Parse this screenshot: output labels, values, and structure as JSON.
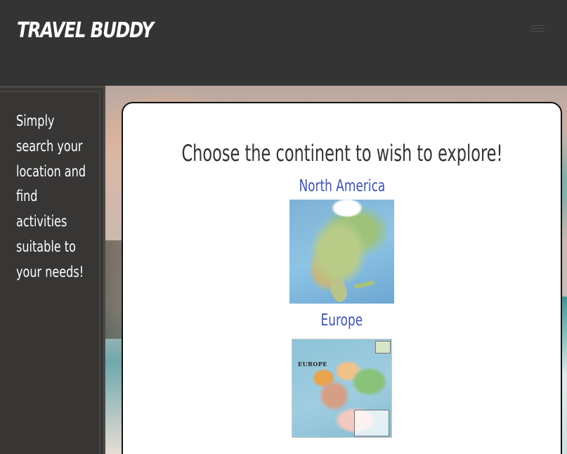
{
  "header": {
    "brand": "TRAVEL BUDDY",
    "menu_icon": "hamburger-menu-icon"
  },
  "sidebar": {
    "text": "Simply search your location and find activities suitable to your needs!"
  },
  "main": {
    "title": "Choose the continent to wish to explore!",
    "continents": [
      {
        "label": "North America",
        "image": "north-america-map"
      },
      {
        "label": "Europe",
        "image": "europe-map"
      }
    ]
  },
  "maps": {
    "europe_title": "EUROPE"
  },
  "colors": {
    "header_bg": "#343434",
    "sidebar_bg": "#383635",
    "card_bg": "#ffffff",
    "link": "#3f53b0",
    "title": "#333333"
  }
}
